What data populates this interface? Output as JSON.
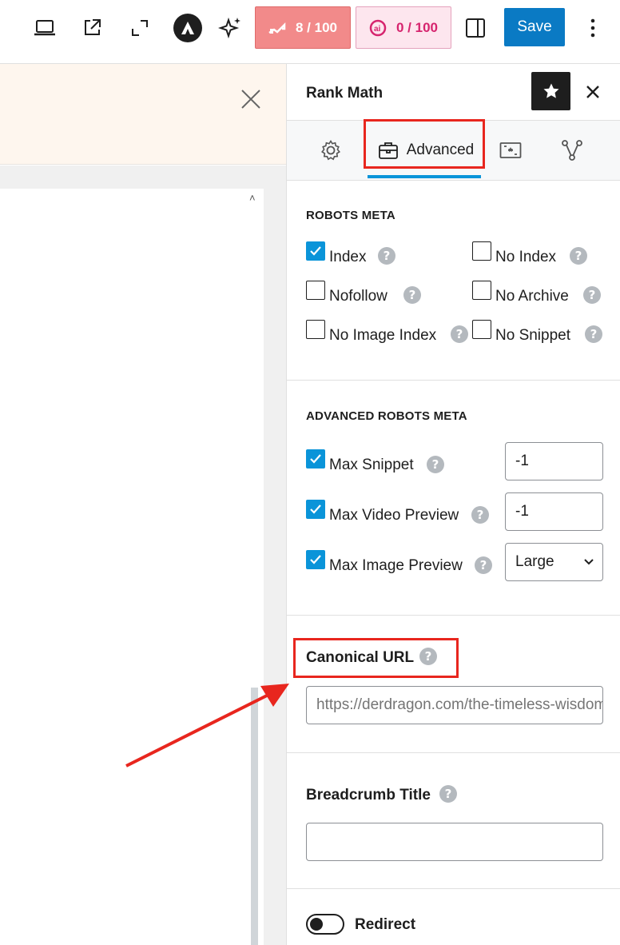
{
  "toolbar": {
    "seo_score": "8 / 100",
    "ai_score": "0 / 100",
    "save_label": "Save",
    "icons": [
      "laptop-icon",
      "external-link-icon",
      "fullscreen-icon",
      "astra-logo-icon",
      "ai-sparkle-icon",
      "rank-math-icon",
      "content-ai-icon",
      "sidebar-toggle-icon",
      "more-vertical-icon"
    ]
  },
  "editor": {
    "close_icon": "close-icon",
    "scroll_up_glyph": "˄"
  },
  "sidebar": {
    "title": "Rank Math",
    "tabs": [
      {
        "label": "",
        "icon": "gear-icon"
      },
      {
        "label": "Advanced",
        "icon": "briefcase-icon"
      },
      {
        "label": "",
        "icon": "schema-card-icon"
      },
      {
        "label": "",
        "icon": "share-nodes-icon"
      }
    ],
    "robots_meta": {
      "title": "ROBOTS META",
      "items": [
        {
          "label": "Index",
          "checked": true
        },
        {
          "label": "No Index",
          "checked": false
        },
        {
          "label": "Nofollow",
          "checked": false
        },
        {
          "label": "No Archive",
          "checked": false
        },
        {
          "label": "No Image Index",
          "checked": false
        },
        {
          "label": "No Snippet",
          "checked": false
        }
      ]
    },
    "advanced_robots_meta": {
      "title": "ADVANCED ROBOTS META",
      "items": [
        {
          "label": "Max Snippet",
          "checked": true,
          "value": "-1"
        },
        {
          "label": "Max Video Preview",
          "checked": true,
          "value": "-1"
        },
        {
          "label": "Max Image Preview",
          "checked": true,
          "value": "Large"
        }
      ]
    },
    "canonical": {
      "title": "Canonical URL",
      "placeholder": "https://derdragon.com/the-timeless-wisdom"
    },
    "breadcrumb": {
      "title": "Breadcrumb Title",
      "value": ""
    },
    "redirect": {
      "label": "Redirect",
      "enabled": false
    },
    "help_glyph": "?"
  },
  "colors": {
    "accent": "#0a94d9",
    "save": "#0a7ac4",
    "seo_score_bg": "#f28a8a",
    "ai_score_text": "#d6246e",
    "annotation_red": "#e8261e"
  }
}
